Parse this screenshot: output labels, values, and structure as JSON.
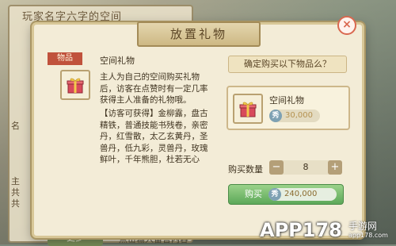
{
  "background": {
    "window_title": "玩家名字六字的空间",
    "side_text_1": "名",
    "side_text_2": "主\n共\n共",
    "more_button": "更多",
    "hint": "点击输入留言内容"
  },
  "dialog": {
    "title": "放置礼物",
    "close_icon": "close-icon"
  },
  "item": {
    "tag": "物品",
    "name": "空间礼物",
    "description": "主人为自己的空间购买礼物后，访客在点赞时有一定几率获得主人准备的礼物哦。",
    "reward_text": "【访客可获得】金柳露，盘古精铁，普通技能书残卷，亲密丹，红雪散，太乙玄黄丹，圣兽丹，低九彩，灵兽丹，玫瑰鲜叶，千年熊胆，杜若无心",
    "icon": "gift-icon"
  },
  "purchase": {
    "confirm_text": "确定购买以下物品么？",
    "card_name": "空间礼物",
    "card_price": "30,000",
    "coin_label": "秀",
    "quantity_label": "购买数量",
    "quantity": "8",
    "minus_label": "−",
    "plus_label": "+",
    "buy_label": "购买",
    "buy_total": "240,000"
  },
  "watermark": {
    "brand": "APP178",
    "brand_cn": "手游网",
    "url": "app178.com"
  },
  "colors": {
    "tag_red": "#c0523c",
    "buy_green": "#5ca859",
    "close_red": "#d9684f"
  }
}
